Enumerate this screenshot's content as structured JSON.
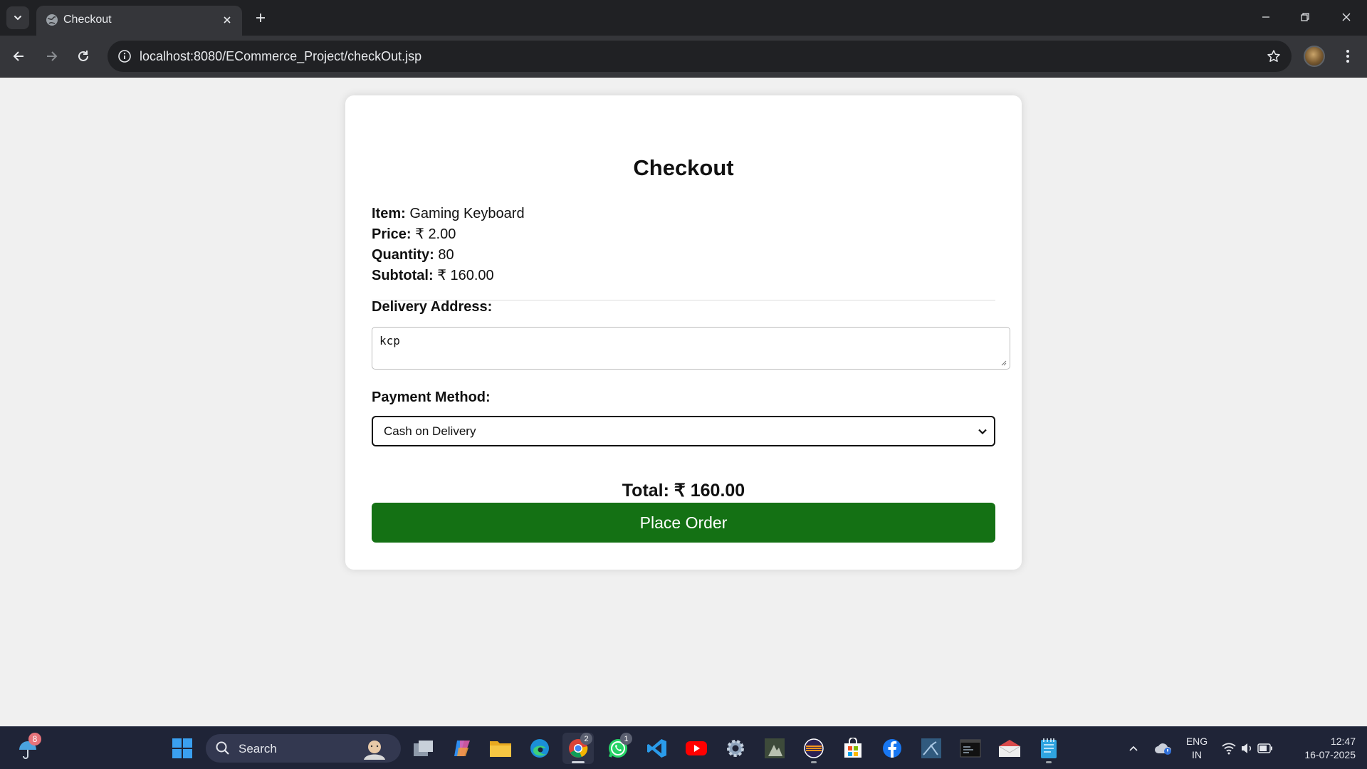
{
  "browser": {
    "tab_title": "Checkout",
    "url": "localhost:8080/ECommerce_Project/checkOut.jsp"
  },
  "checkout": {
    "heading": "Checkout",
    "item_label": "Item:",
    "item_value": "Gaming Keyboard",
    "price_label": "Price:",
    "price_value": "₹ 2.00",
    "quantity_label": "Quantity:",
    "quantity_value": "80",
    "subtotal_label": "Subtotal:",
    "subtotal_value": "₹ 160.00",
    "address_label": "Delivery Address:",
    "address_value": "kcp",
    "payment_label": "Payment Method:",
    "payment_selected": "Cash on Delivery",
    "total_text": "Total: ₹ 160.00",
    "place_order_label": "Place Order"
  },
  "taskbar": {
    "weather_badge": "8",
    "search_label": "Search",
    "chrome_badge": "2",
    "whatsapp_badge": "1",
    "lang_line1": "ENG",
    "lang_line2": "IN",
    "time": "12:47",
    "date": "16-07-2025"
  },
  "colors": {
    "place_order_bg": "#147114",
    "page_bg": "#f0f0f0",
    "taskbar_bg": "#1f2437"
  }
}
